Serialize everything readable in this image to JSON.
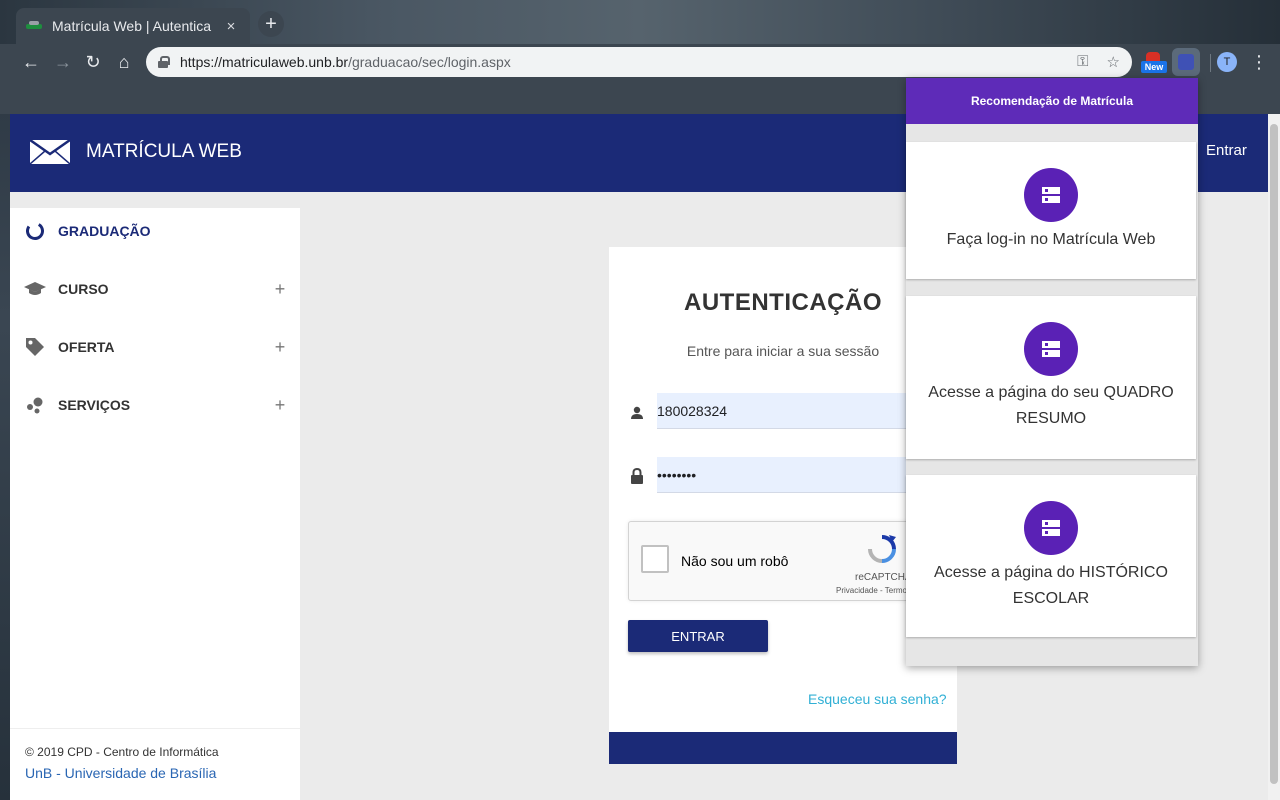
{
  "browser": {
    "tab_title": "Matrícula Web | Autentica",
    "tab_close": "×",
    "new_tab": "+",
    "url_host": "https://matriculaweb.unb.br",
    "url_path": "/graduacao/sec/login.aspx",
    "ext_badge": "New",
    "profile_initial": "T"
  },
  "header": {
    "brand": "MATRÍCULA WEB",
    "login_link": "Entrar"
  },
  "sidebar": {
    "items": [
      {
        "label": "GRADUAÇÃO",
        "icon": "circle-notch-icon",
        "has_plus": false
      },
      {
        "label": "CURSO",
        "icon": "graduation-cap-icon",
        "has_plus": true
      },
      {
        "label": "OFERTA",
        "icon": "tag-icon",
        "has_plus": true
      },
      {
        "label": "SERVIÇOS",
        "icon": "services-dots-icon",
        "has_plus": true
      }
    ],
    "plus": "+",
    "footer_copy": "© 2019 CPD - Centro de Informática",
    "footer_univ": "UnB - Universidade de Brasília"
  },
  "auth": {
    "title": "AUTENTICAÇÃO",
    "subtitle": "Entre para iniciar a sua sessão",
    "username_value": "180028324",
    "password_value": "••••••••",
    "captcha_label": "Não sou um robô",
    "captcha_brand": "reCAPTCHA",
    "captcha_terms": "Privacidade - Termos",
    "submit": "ENTRAR",
    "forgot": "Esqueceu sua senha?"
  },
  "popup": {
    "title": "Recomendação de Matrícula",
    "cards": [
      {
        "text": "Faça log-in no Matrícula Web"
      },
      {
        "text": "Acesse a página do seu QUADRO RESUMO"
      },
      {
        "text": "Acesse a página do HISTÓRICO ESCOLAR"
      }
    ]
  },
  "colors": {
    "brand_navy": "#1b2a77",
    "popup_purple": "#5e2bb8",
    "avatar_purple": "#5a21b5",
    "link_cyan": "#31b0d5",
    "autofill_blue": "#e8f0fe"
  }
}
